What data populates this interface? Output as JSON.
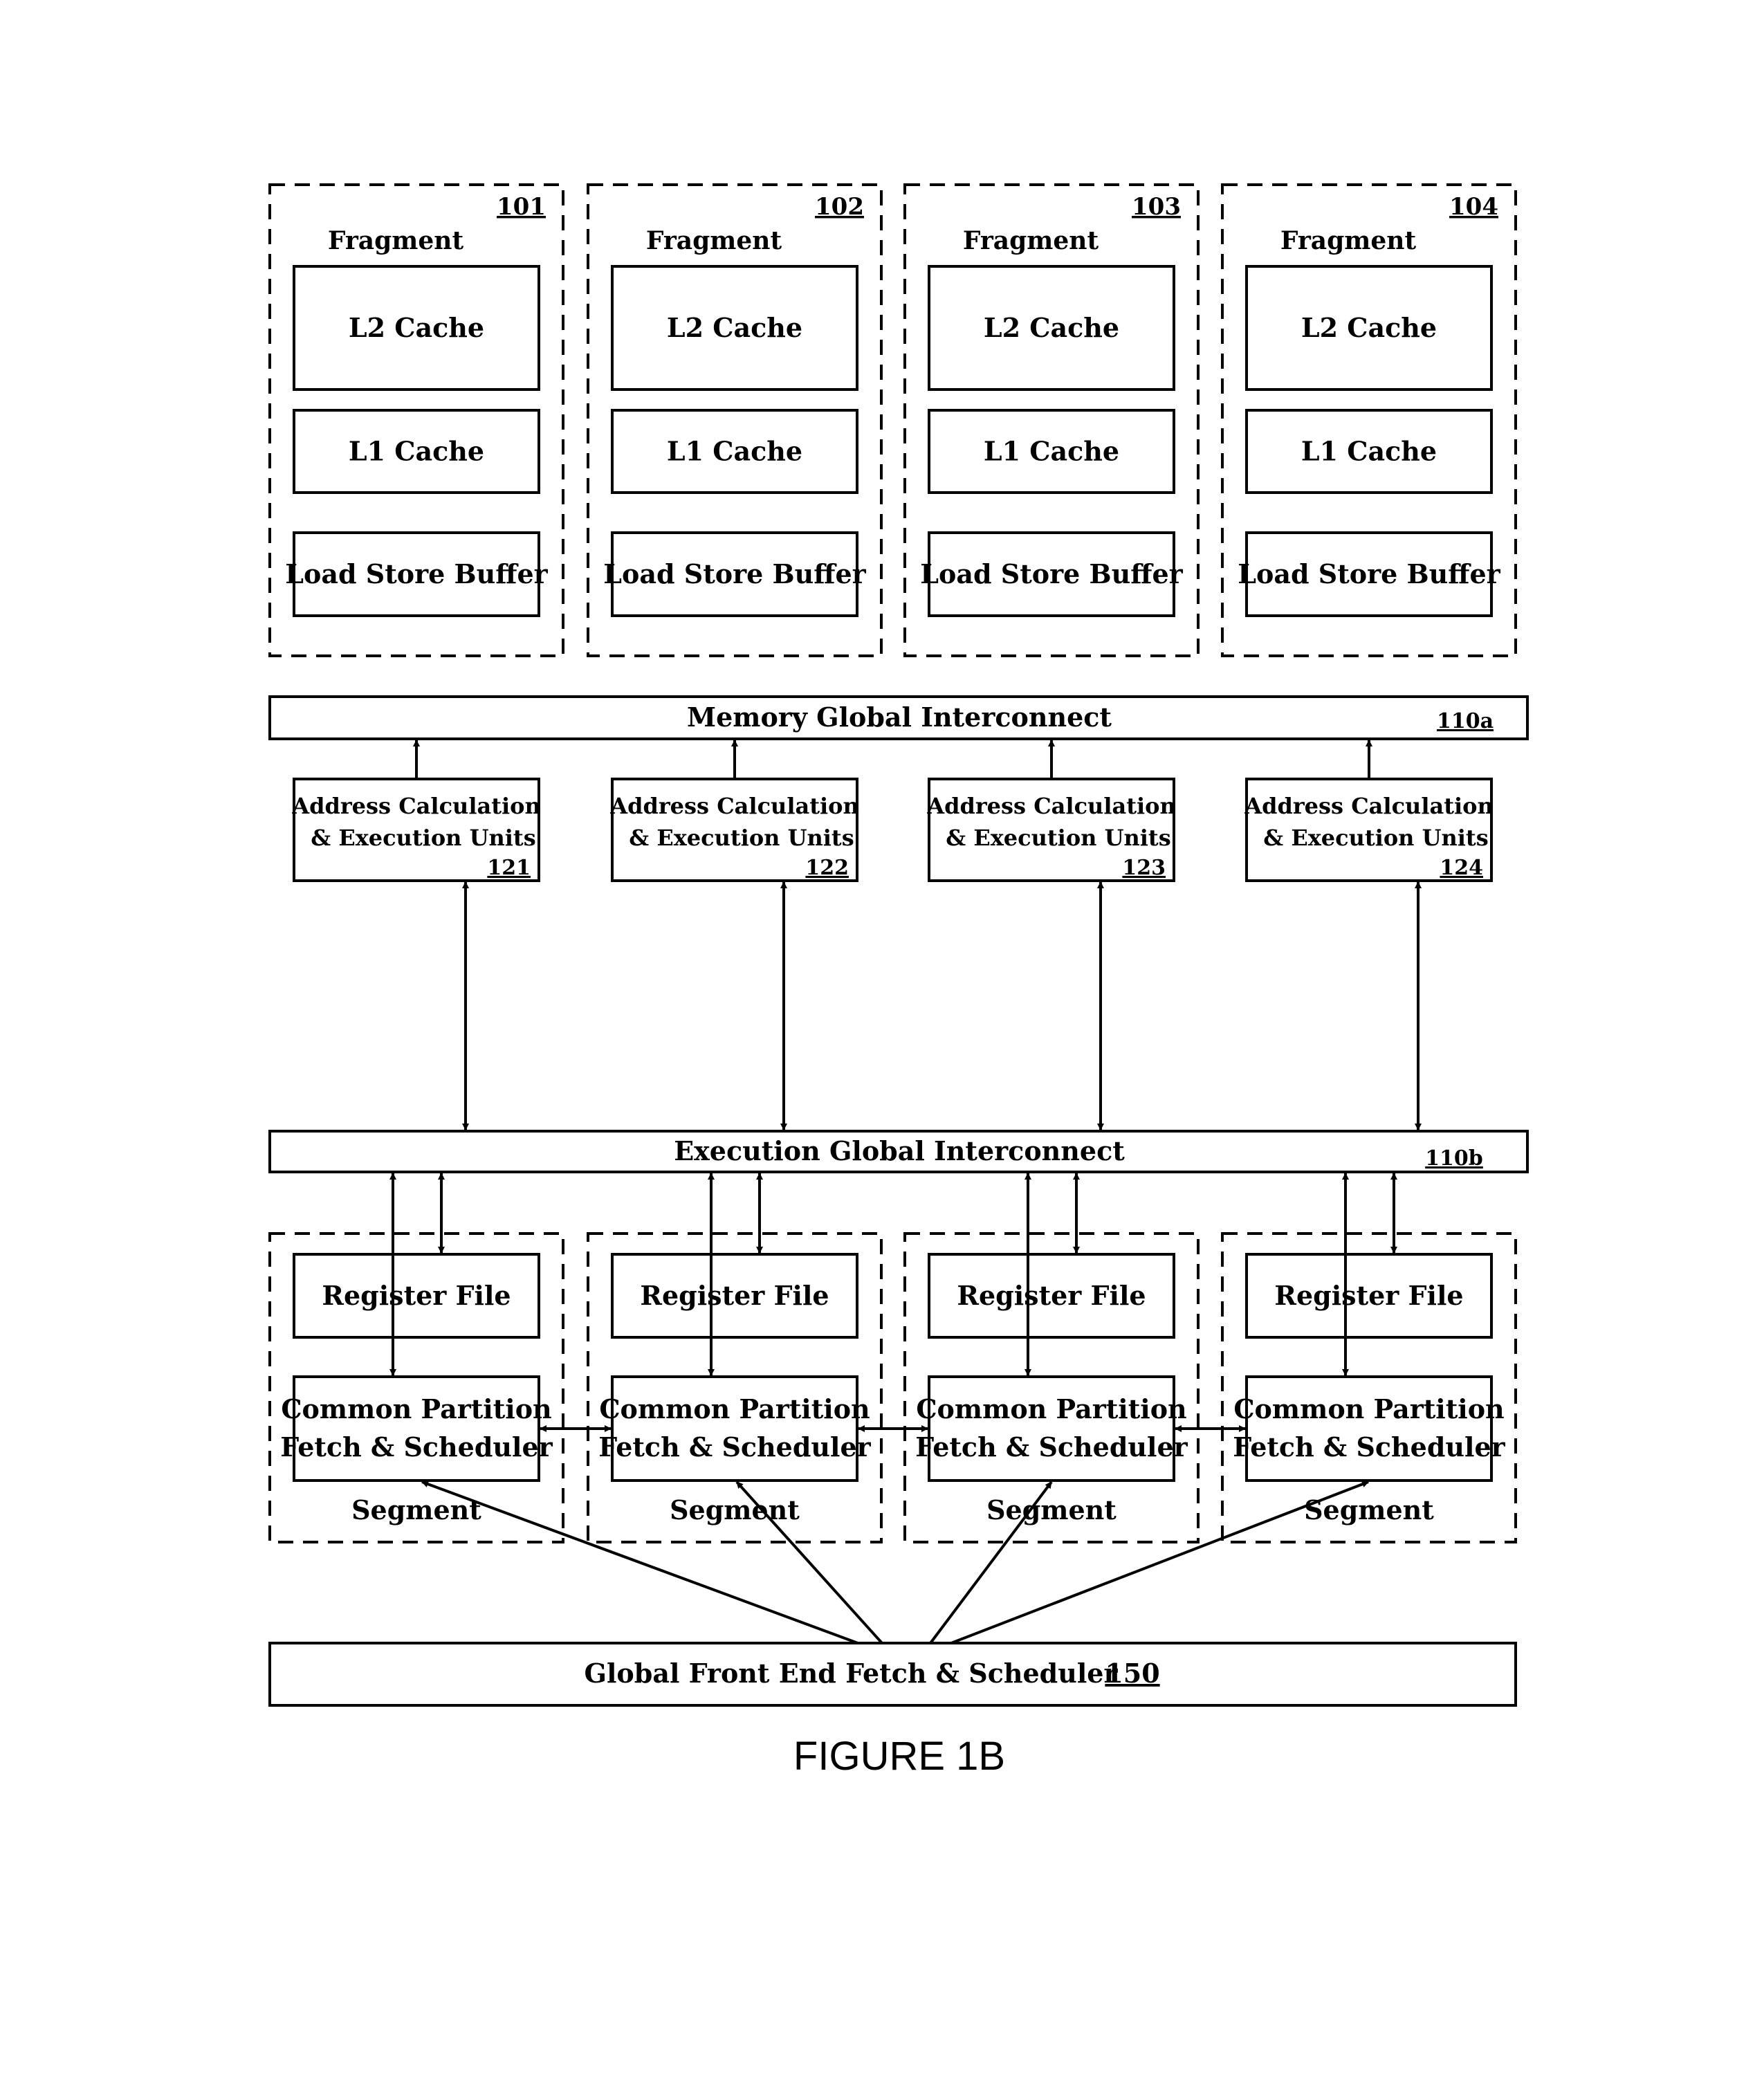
{
  "figure_label": "FIGURE 1B",
  "fragments": [
    {
      "ref": "101",
      "title": "Fragment",
      "l2": "L2 Cache",
      "l1": "L1 Cache",
      "lsb": "Load Store Buffer"
    },
    {
      "ref": "102",
      "title": "Fragment",
      "l2": "L2 Cache",
      "l1": "L1 Cache",
      "lsb": "Load Store Buffer"
    },
    {
      "ref": "103",
      "title": "Fragment",
      "l2": "L2 Cache",
      "l1": "L1 Cache",
      "lsb": "Load Store Buffer"
    },
    {
      "ref": "104",
      "title": "Fragment",
      "l2": "L2 Cache",
      "l1": "L1 Cache",
      "lsb": "Load Store Buffer"
    }
  ],
  "memory_interconnect": {
    "label": "Memory Global Interconnect",
    "ref": "110a"
  },
  "execution_units": [
    {
      "line1": "Address Calculation",
      "line2": "& Execution Units",
      "ref": "121"
    },
    {
      "line1": "Address Calculation",
      "line2": "& Execution Units",
      "ref": "122"
    },
    {
      "line1": "Address Calculation",
      "line2": "& Execution Units",
      "ref": "123"
    },
    {
      "line1": "Address Calculation",
      "line2": "& Execution Units",
      "ref": "124"
    }
  ],
  "execution_interconnect": {
    "label": "Execution Global Interconnect",
    "ref": "110b"
  },
  "segments": [
    {
      "title": "Segment",
      "register_file": "Register File",
      "cpfs_line1": "Common Partition",
      "cpfs_line2": "Fetch & Scheduler"
    },
    {
      "title": "Segment",
      "register_file": "Register File",
      "cpfs_line1": "Common Partition",
      "cpfs_line2": "Fetch & Scheduler"
    },
    {
      "title": "Segment",
      "register_file": "Register File",
      "cpfs_line1": "Common Partition",
      "cpfs_line2": "Fetch & Scheduler"
    },
    {
      "title": "Segment",
      "register_file": "Register File",
      "cpfs_line1": "Common Partition",
      "cpfs_line2": "Fetch & Scheduler"
    }
  ],
  "global_front_end": {
    "label": "Global Front End Fetch & Scheduler",
    "ref": "150"
  }
}
